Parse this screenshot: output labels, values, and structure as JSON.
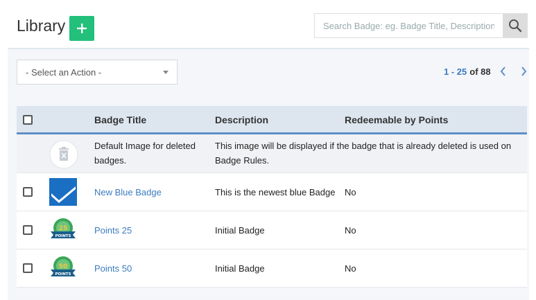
{
  "header": {
    "title": "Library",
    "add_label": "+",
    "search_placeholder": "Search Badge: eg. Badge Title, Description"
  },
  "toolbar": {
    "action_select": "- Select an Action -",
    "pager_range": "1 - 25",
    "pager_total": "of 88"
  },
  "table": {
    "columns": [
      "Badge Title",
      "Description",
      "Redeemable by Points"
    ],
    "deleted_row": {
      "title": "Default Image for deleted badges.",
      "description": "This image will be displayed if the badge that is already deleted is used on Badge Rules."
    },
    "rows": [
      {
        "title": "New Blue Badge",
        "description": "This is the newest blue Badge",
        "redeemable": "No",
        "icon": "blue-check-badge"
      },
      {
        "title": "Points 25",
        "description": "Initial Badge",
        "redeemable": "No",
        "icon": "points-badge",
        "badge_number": "25",
        "badge_text": "POINTS"
      },
      {
        "title": "Points 50",
        "description": "Initial Badge",
        "redeemable": "No",
        "icon": "points-badge",
        "badge_number": "50",
        "badge_text": "POINTS"
      }
    ]
  },
  "colors": {
    "accent_green": "#22c07a",
    "link_blue": "#3b7cbf",
    "header_border": "#5f8fc6",
    "badge_blue": "#1a6fc2",
    "points_green": "#3aa657",
    "points_ribbon": "#1a5e8a"
  }
}
